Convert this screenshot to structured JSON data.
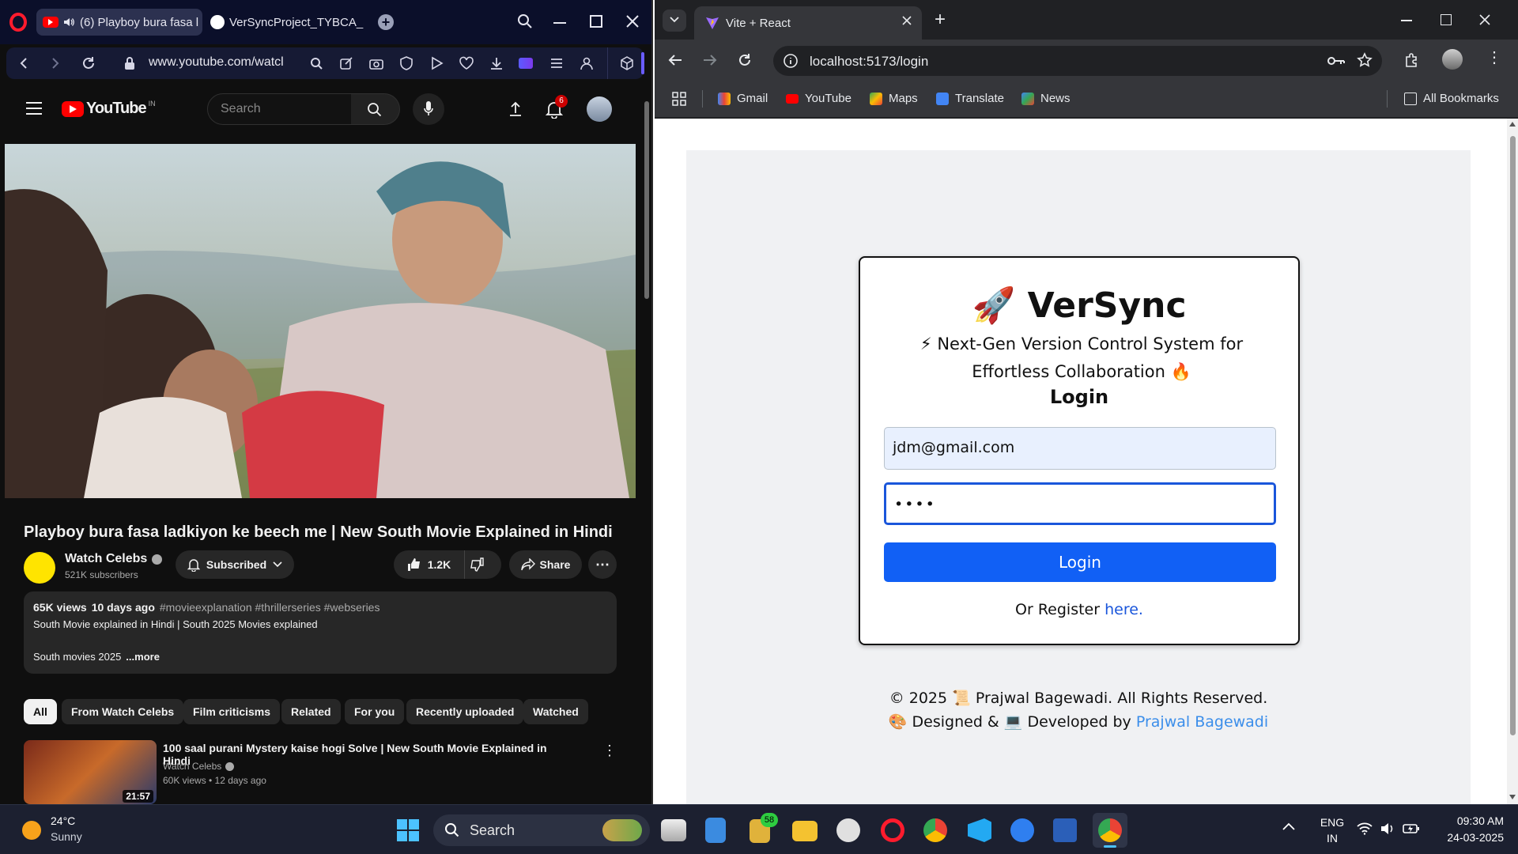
{
  "opera": {
    "tabs": [
      {
        "label": "(6) Playboy bura fasa l"
      },
      {
        "label": "VerSyncProject_TYBCA_SE"
      }
    ],
    "url": "www.youtube.com/watcl"
  },
  "youtube": {
    "logo": "YouTube",
    "region": "IN",
    "search_placeholder": "Search",
    "notif_count": "6",
    "video_title": "Playboy bura fasa ladkiyon ke beech me | New South Movie Explained in Hindi",
    "channel": {
      "name": "Watch Celebs",
      "subscribers": "521K subscribers",
      "subscribed_label": "Subscribed"
    },
    "likes": "1.2K",
    "share_label": "Share",
    "description": {
      "views": "65K views",
      "age": "10 days ago",
      "hashtags": "#movieexplanation #thrillerseries #webseries",
      "line1": "South Movie explained in Hindi | South 2025 Movies explained",
      "line2": "South movies 2025",
      "more": "...more"
    },
    "chips": [
      "All",
      "From Watch Celebs",
      "Film criticisms",
      "Related",
      "For you",
      "Recently uploaded",
      "Watched"
    ],
    "recommended": [
      {
        "title": "100 saal purani Mystery kaise hogi Solve | New South Movie Explained in Hindi",
        "channel": "Watch Celebs",
        "meta": "60K views • 12 days ago",
        "duration": "21:57"
      }
    ]
  },
  "chrome": {
    "tab_title": "Vite + React",
    "url": "localhost:5173/login",
    "bookmarks": [
      "Gmail",
      "YouTube",
      "Maps",
      "Translate",
      "News"
    ],
    "all_bookmarks": "All Bookmarks"
  },
  "app": {
    "brand_emoji": "🚀",
    "brand": "VerSync",
    "tagline_lead": "⚡",
    "tagline": "Next-Gen Version Control System for Effortless Collaboration",
    "tagline_trail": "🔥",
    "heading": "Login",
    "email_value": "jdm@gmail.com",
    "password_mask": "••••",
    "login_button": "Login",
    "register_prefix": "Or Register",
    "register_link": "here.",
    "footer_line1": "© 2025 📜 Prajwal Bagewadi. All Rights Reserved.",
    "footer_line2_prefix": "🎨 Designed & 💻 Developed by",
    "footer_author": "Prajwal Bagewadi"
  },
  "taskbar": {
    "weather_temp": "24°C",
    "weather_desc": "Sunny",
    "search_label": "Search",
    "badge_count": "58",
    "lang_top": "ENG",
    "lang_bottom": "IN",
    "time": "09:30 AM",
    "date": "24-03-2025"
  },
  "colors": {
    "primary_button": "#1160f5",
    "link": "#1a56db",
    "youtube_red": "#ff0000"
  }
}
